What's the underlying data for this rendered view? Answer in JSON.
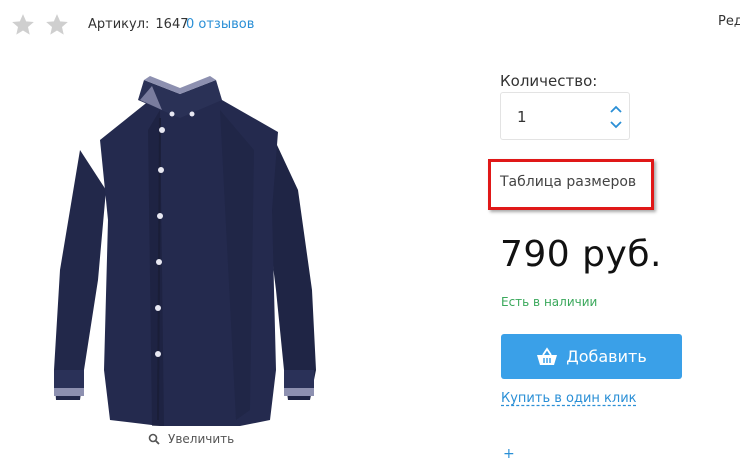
{
  "header": {
    "sku_label": "Артикул:",
    "sku_value": "1647",
    "reviews_link": "0 отзывов",
    "edit_label": "Ред",
    "rating_stars": 2
  },
  "gallery": {
    "zoom_label": "Увеличить"
  },
  "quantity": {
    "label": "Количество:",
    "value": "1"
  },
  "size_table_link": "Таблица размеров",
  "price": "790 руб.",
  "stock_status": "Есть в наличии",
  "add_button_label": "Добавить",
  "one_click_link": "Купить в один клик",
  "plus_label": "+",
  "colors": {
    "accent_blue": "#3aa0e8",
    "link_blue": "#2a8fd6",
    "in_stock_green": "#3aa85b",
    "highlight_red": "#e01818",
    "shirt_navy": "#22284a"
  }
}
